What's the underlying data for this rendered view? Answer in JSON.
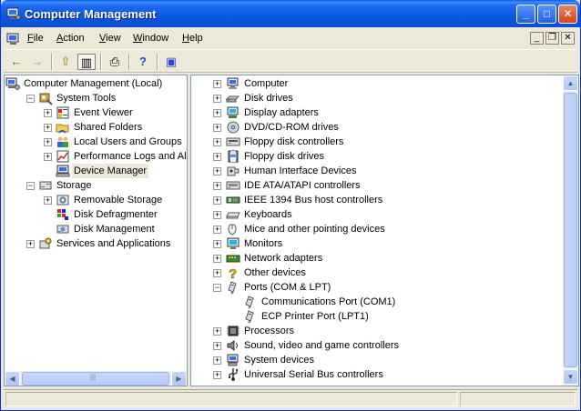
{
  "window": {
    "title": "Computer Management",
    "controls": {
      "minimize": "_",
      "maximize": "□",
      "close": "✕"
    }
  },
  "menu": [
    {
      "label": "File",
      "key": "F",
      "rest": "ile"
    },
    {
      "label": "Action",
      "key": "A",
      "rest": "ction"
    },
    {
      "label": "View",
      "key": "V",
      "rest": "iew"
    },
    {
      "label": "Window",
      "key": "W",
      "rest": "indow"
    },
    {
      "label": "Help",
      "key": "H",
      "rest": "elp"
    }
  ],
  "mdi_controls": {
    "minimize": "_",
    "restore": "❐",
    "close": "✕"
  },
  "toolbar": {
    "back": "←",
    "forward": "→",
    "up": "⇧",
    "show_hide_tree": "▥",
    "print": "⎙",
    "help": "?",
    "properties": "▣"
  },
  "tree": [
    {
      "label": "Computer Management (Local)",
      "icon": "computer-management-icon",
      "expander": "",
      "indent": 0
    },
    {
      "label": "System Tools",
      "icon": "system-tools-icon",
      "expander": "−",
      "indent": 1
    },
    {
      "label": "Event Viewer",
      "icon": "event-viewer-icon",
      "expander": "+",
      "indent": 2
    },
    {
      "label": "Shared Folders",
      "icon": "shared-folders-icon",
      "expander": "+",
      "indent": 2
    },
    {
      "label": "Local Users and Groups",
      "icon": "users-groups-icon",
      "expander": "+",
      "indent": 2
    },
    {
      "label": "Performance Logs and Alerts",
      "icon": "performance-logs-icon",
      "expander": "+",
      "indent": 2
    },
    {
      "label": "Device Manager",
      "icon": "device-manager-icon",
      "expander": "",
      "indent": 2,
      "selected": true
    },
    {
      "label": "Storage",
      "icon": "storage-icon",
      "expander": "−",
      "indent": 1
    },
    {
      "label": "Removable Storage",
      "icon": "removable-storage-icon",
      "expander": "+",
      "indent": 2
    },
    {
      "label": "Disk Defragmenter",
      "icon": "disk-defragmenter-icon",
      "expander": "",
      "indent": 2
    },
    {
      "label": "Disk Management",
      "icon": "disk-management-icon",
      "expander": "",
      "indent": 2
    },
    {
      "label": "Services and Applications",
      "icon": "services-applications-icon",
      "expander": "+",
      "indent": 1
    }
  ],
  "devices": [
    {
      "label": "Computer",
      "icon": "computer-icon",
      "expander": "+",
      "indent": 0
    },
    {
      "label": "Disk drives",
      "icon": "disk-drive-icon",
      "expander": "+",
      "indent": 0
    },
    {
      "label": "Display adapters",
      "icon": "display-adapter-icon",
      "expander": "+",
      "indent": 0
    },
    {
      "label": "DVD/CD-ROM drives",
      "icon": "cdrom-icon",
      "expander": "+",
      "indent": 0
    },
    {
      "label": "Floppy disk controllers",
      "icon": "floppy-controller-icon",
      "expander": "+",
      "indent": 0
    },
    {
      "label": "Floppy disk drives",
      "icon": "floppy-drive-icon",
      "expander": "+",
      "indent": 0
    },
    {
      "label": "Human Interface Devices",
      "icon": "hid-icon",
      "expander": "+",
      "indent": 0
    },
    {
      "label": "IDE ATA/ATAPI controllers",
      "icon": "ide-controller-icon",
      "expander": "+",
      "indent": 0
    },
    {
      "label": "IEEE 1394 Bus host controllers",
      "icon": "ieee1394-icon",
      "expander": "+",
      "indent": 0
    },
    {
      "label": "Keyboards",
      "icon": "keyboard-icon",
      "expander": "+",
      "indent": 0
    },
    {
      "label": "Mice and other pointing devices",
      "icon": "mouse-icon",
      "expander": "+",
      "indent": 0
    },
    {
      "label": "Monitors",
      "icon": "monitor-icon",
      "expander": "+",
      "indent": 0
    },
    {
      "label": "Network adapters",
      "icon": "network-adapter-icon",
      "expander": "+",
      "indent": 0
    },
    {
      "label": "Other devices",
      "icon": "other-devices-icon",
      "expander": "+",
      "indent": 0
    },
    {
      "label": "Ports (COM & LPT)",
      "icon": "port-icon",
      "expander": "−",
      "indent": 0
    },
    {
      "label": "Communications Port (COM1)",
      "icon": "port-icon",
      "expander": "",
      "indent": 1
    },
    {
      "label": "ECP Printer Port (LPT1)",
      "icon": "port-icon",
      "expander": "",
      "indent": 1
    },
    {
      "label": "Processors",
      "icon": "processor-icon",
      "expander": "+",
      "indent": 0
    },
    {
      "label": "Sound, video and game controllers",
      "icon": "sound-icon",
      "expander": "+",
      "indent": 0
    },
    {
      "label": "System devices",
      "icon": "system-device-icon",
      "expander": "+",
      "indent": 0
    },
    {
      "label": "Universal Serial Bus controllers",
      "icon": "usb-icon",
      "expander": "+",
      "indent": 0
    }
  ],
  "scrollbar": {
    "left_arrow": "◀",
    "right_arrow": "▶",
    "up_arrow": "▲",
    "down_arrow": "▼",
    "grip": "|||"
  }
}
